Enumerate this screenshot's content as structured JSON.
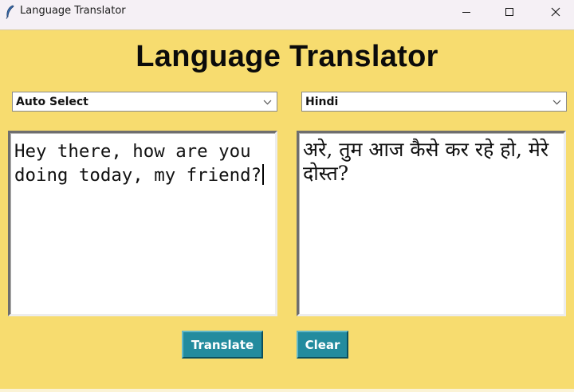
{
  "window": {
    "title": "Language Translator",
    "icon": "feather-icon"
  },
  "header": {
    "title": "Language Translator"
  },
  "source_language": {
    "selected": "Auto Select"
  },
  "target_language": {
    "selected": "Hindi"
  },
  "input_text": "Hey there, how are you doing today, my friend?",
  "output_text": "अरे, तुम आज कैसे कर रहे हो, मेरे दोस्त?",
  "buttons": {
    "translate": "Translate",
    "clear": "Clear"
  },
  "colors": {
    "background": "#f7dc6f",
    "button": "#238b9e",
    "button_text": "#ffffff"
  }
}
